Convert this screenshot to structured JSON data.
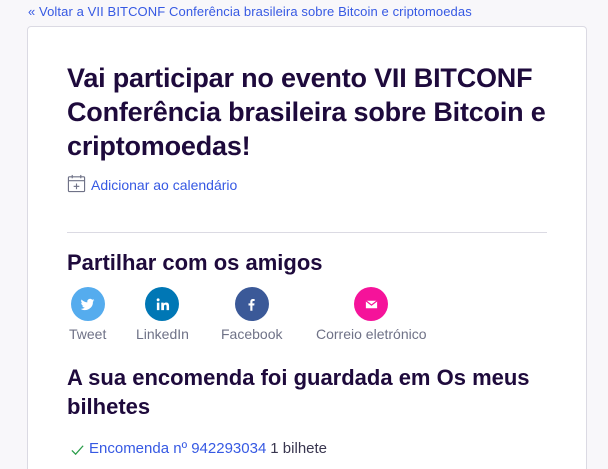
{
  "back_link": "« Voltar a VII BITCONF Conferência brasileira sobre Bitcoin e criptomoedas",
  "title": "Vai participar no evento VII BITCONF Conferência brasileira sobre Bitcoin e criptomoedas!",
  "calendar": {
    "label": "Adicionar ao calendário",
    "icon": "calendar-plus-icon"
  },
  "share": {
    "heading": "Partilhar com os amigos",
    "items": [
      {
        "label": "Tweet",
        "icon": "twitter-icon",
        "color": "#55acee"
      },
      {
        "label": "LinkedIn",
        "icon": "linkedin-icon",
        "color": "#0077b5"
      },
      {
        "label": "Facebook",
        "icon": "facebook-icon",
        "color": "#3b5998"
      },
      {
        "label": "Correio eletrónico",
        "icon": "email-icon",
        "color": "#f5139a"
      }
    ]
  },
  "order": {
    "heading": "A sua encomenda foi guardada em Os meus bilhetes",
    "link_label": "Encomenda nº 942293034",
    "count": "1 bilhete",
    "icon": "check-icon"
  },
  "colors": {
    "link": "#3659e3",
    "heading": "#1e0a3c",
    "check": "#2a9d4a"
  }
}
